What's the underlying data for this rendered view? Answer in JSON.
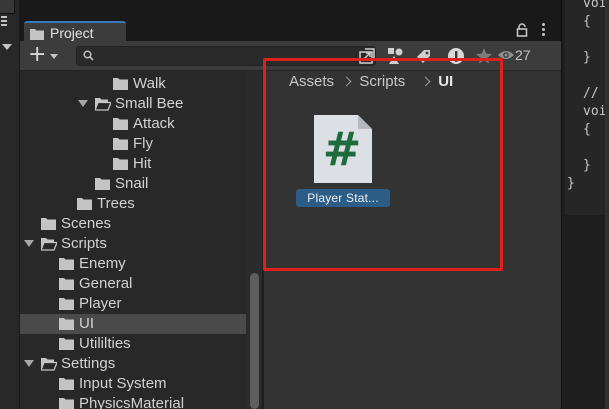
{
  "project_tab": {
    "title": "Project"
  },
  "toolbar": {
    "add_label": "+",
    "search_value": "",
    "visible_count": "27"
  },
  "tree": {
    "items": [
      {
        "label": "Walk",
        "depth": 5,
        "expanded": null
      },
      {
        "label": "Small Bee",
        "depth": 4,
        "expanded": true
      },
      {
        "label": "Attack",
        "depth": 5,
        "expanded": null
      },
      {
        "label": "Fly",
        "depth": 5,
        "expanded": null
      },
      {
        "label": "Hit",
        "depth": 5,
        "expanded": null
      },
      {
        "label": "Snail",
        "depth": 4,
        "expanded": null
      },
      {
        "label": "Trees",
        "depth": 3,
        "expanded": null
      },
      {
        "label": "Scenes",
        "depth": 1,
        "expanded": null
      },
      {
        "label": "Scripts",
        "depth": 1,
        "expanded": true
      },
      {
        "label": "Enemy",
        "depth": 2,
        "expanded": null
      },
      {
        "label": "General",
        "depth": 2,
        "expanded": null
      },
      {
        "label": "Player",
        "depth": 2,
        "expanded": null
      },
      {
        "label": "UI",
        "depth": 2,
        "expanded": null,
        "selected": true
      },
      {
        "label": "Utililties",
        "depth": 2,
        "expanded": null
      },
      {
        "label": "Settings",
        "depth": 1,
        "expanded": true
      },
      {
        "label": "Input System",
        "depth": 2,
        "expanded": null
      },
      {
        "label": "PhysicsMaterial",
        "depth": 2,
        "expanded": null
      }
    ]
  },
  "breadcrumb": {
    "items": [
      "Assets",
      "Scripts",
      "UI"
    ]
  },
  "assets": [
    {
      "name": "Player Stat...",
      "icon": "csharp-script-icon",
      "glyph": "#"
    }
  ],
  "code_panel": {
    "lines": [
      "voic",
      "{",
      "",
      "}",
      "",
      "// U",
      "voic",
      "{",
      "",
      "}",
      "}"
    ]
  },
  "colors": {
    "selection_blue": "#2c5d87",
    "tab_accent": "#3a79bb",
    "highlight_red": "#e0201c",
    "script_hash": "#1e6b3c"
  }
}
